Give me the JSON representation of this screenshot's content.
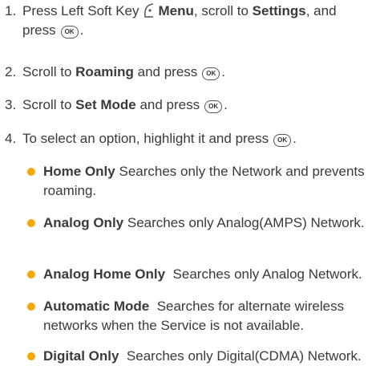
{
  "colors": {
    "bullet": "#f5a800",
    "text": "#3a3a3a"
  },
  "icons": {
    "soft_key": "left-soft-key-icon",
    "ok": "ok-key-icon"
  },
  "ok_label": "OK",
  "steps": [
    {
      "num": "1.",
      "p1": "Press Left Soft Key",
      "b1": "Menu",
      "p2": ", scroll to",
      "b2": "Settings",
      "p3": ", and",
      "p4": "press",
      "end": "."
    },
    {
      "num": "2.",
      "p1": "Scroll to",
      "b1": "Roaming",
      "p2": "and press",
      "end": "."
    },
    {
      "num": "3.",
      "p1": "Scroll to",
      "b1": "Set Mode",
      "p2": "and press",
      "end": "."
    },
    {
      "num": "4.",
      "p1": "To select an option, highlight it and press",
      "end": "."
    }
  ],
  "options": [
    {
      "name": "Home Only",
      "desc": "Searches only the Network and prevents roaming."
    },
    {
      "name": "Analog Only",
      "desc": "Searches only Analog(AMPS) Network."
    },
    {
      "name": "Analog Home Only",
      "desc": "Searches only Analog Network."
    },
    {
      "name": "Automatic Mode",
      "desc": "Searches for alternate wireless networks when the Service is not available."
    },
    {
      "name": "Digital Only",
      "desc": "Searches only Digital(CDMA) Network."
    }
  ]
}
